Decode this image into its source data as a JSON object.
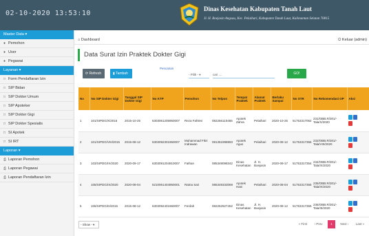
{
  "topbar": {
    "datetime": "02-10-2020 13:53:10",
    "title": "Dinas Kesehatan Kabupaten Tanah Laut",
    "address": "Jl. H. Boejasin Angsau, Kec. Pelaihari, Kabupaten Tanah Laut, Kalimantan Selatan 70815"
  },
  "sidebar": {
    "master_head": "Master Data ▾",
    "master_items": [
      {
        "label": "Pemohon",
        "icon": "user-icon"
      },
      {
        "label": "User",
        "icon": "users-icon"
      },
      {
        "label": "Pegawai",
        "icon": "user-icon"
      }
    ],
    "layanan_head": "Layanan ▾",
    "layanan_items": [
      {
        "label": "Form Pendaftaran Izin",
        "icon": "document-icon"
      },
      {
        "label": "SIP Bidan",
        "icon": "document-icon"
      },
      {
        "label": "SIP Dokter Umum",
        "icon": "document-icon"
      },
      {
        "label": "SIP Apoteker",
        "icon": "document-icon"
      },
      {
        "label": "SIP Dokter Gigi",
        "icon": "document-icon"
      },
      {
        "label": "SIP Dokter Spesialis",
        "icon": "document-icon"
      },
      {
        "label": "SI Apotek",
        "icon": "document-icon"
      },
      {
        "label": "SI IRT",
        "icon": "document-icon"
      }
    ],
    "laporan_head": "Laporan ▾",
    "laporan_items": [
      {
        "label": "Laporan Pemohon",
        "icon": "print-icon"
      },
      {
        "label": "Laporan Pegawai",
        "icon": "print-icon"
      },
      {
        "label": "Laporan Pendaftaran Izin",
        "icon": "print-icon"
      }
    ]
  },
  "crumb": {
    "label": "Dashboard",
    "logout": "Keluar (admin)"
  },
  "page_title": "Data Surat Izin Praktek Dokter Gigi",
  "toolbar": {
    "refresh": "Refresh",
    "add": "Tambah",
    "search_label": "Pencarian",
    "select_value": "- Pilih -",
    "search_placeholder": "cari ....",
    "go": "GO!"
  },
  "table": {
    "columns": [
      "No",
      "No SIP Dokter Gigi",
      "Tanggal SIP Dokter Gigi",
      "No KTP",
      "Pemohon",
      "No Telpon",
      "Tempat Praktek",
      "Alamat Praktek",
      "Berlaku Sampai",
      "No STR",
      "No Rekomendasi OP",
      "Aksi"
    ],
    "rows": [
      [
        "1",
        "101/SIPDG/X/2015",
        "2015-10-25",
        "6303061205950007",
        "Reza Fahlevi",
        "082256110455",
        "Apotek Zahra",
        "Pelaihari",
        "2020-10-25",
        "51753317052",
        "231/OBB.R/301/-Tala/X/2020"
      ],
      [
        "2",
        "101/SIPDG/VIII/2015",
        "2015-08-12",
        "6303092301950007",
        "Muhammad Fikri Indrawan",
        "081351998893",
        "Apotek Agus",
        "Pelaihari",
        "2020-08-12",
        "51753317355",
        "232/OBB.R/301/-Tala/VIII/2020"
      ],
      [
        "3",
        "103/SIPDG/IX/2020",
        "2020-09-17",
        "6303091204910007",
        "Fathan",
        "085349098342",
        "Dinas Kesehatan",
        "Jl. H. Boejasin",
        "2020-09-17",
        "51753317354",
        "234/OBB.R/301/-Tala/IX/2020"
      ],
      [
        "4",
        "105/SIPDG/IX/2020",
        "2020-08-04",
        "6210061404950001",
        "Ratna Sari",
        "085349333069",
        "Apotek Hani",
        "Pelaihari",
        "2020-08-04",
        "51753317355",
        "235/OBB.R/301/-Tala/IX/2020"
      ],
      [
        "5",
        "106/SIPDG/III/2015",
        "2015-08-12",
        "6303092401960007",
        "Ferdah",
        "082252927452",
        "Dinas Kesehatan",
        "Jl. H. Boejasin",
        "2020-08-12",
        "51753317355",
        "236/OBB.R/301/-Tala/III/2020"
      ]
    ]
  },
  "footer": {
    "show": "- Show -",
    "pager": {
      "first": "« First",
      "prev": "‹ Prev",
      "current": "1",
      "next": "Next ›",
      "last": "Last »"
    }
  },
  "colors": {
    "topbar": "#3f5868",
    "accent": "#1d9dd8",
    "header": "#f0a31c",
    "green": "#29a84a",
    "danger": "#e23b3b"
  }
}
